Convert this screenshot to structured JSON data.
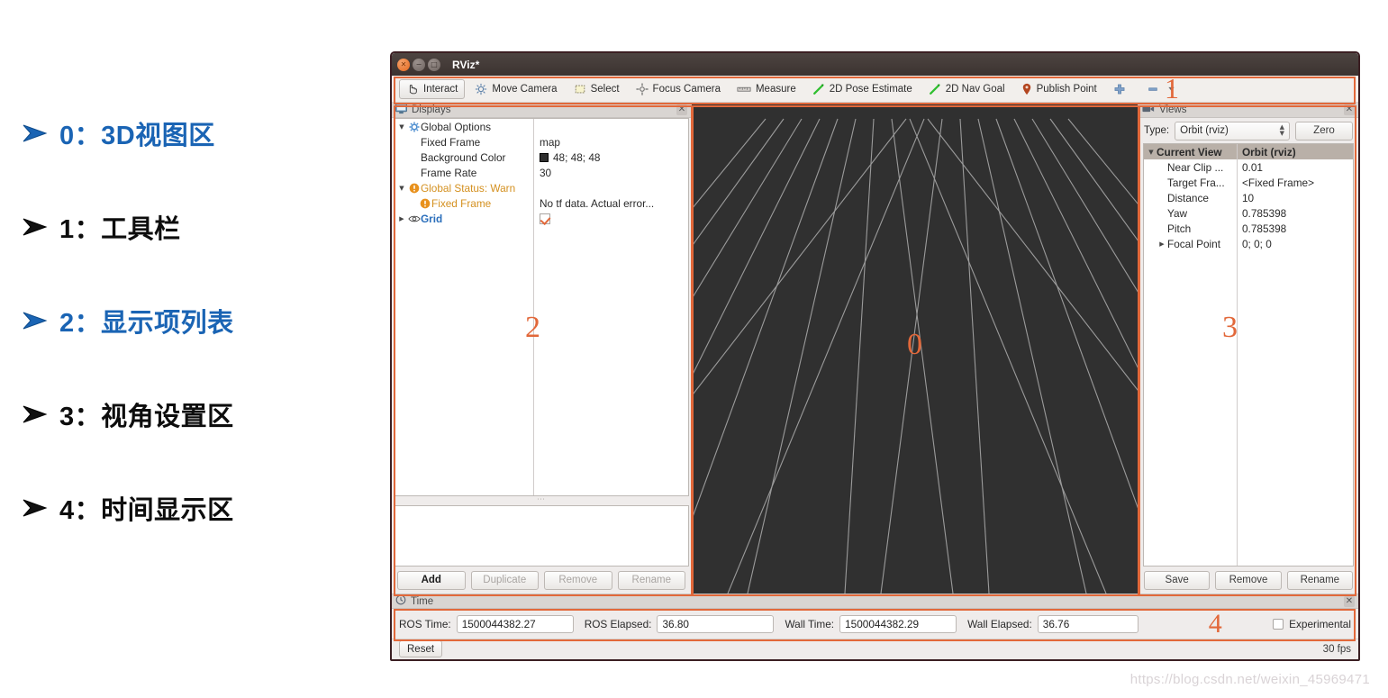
{
  "bullets": [
    {
      "num": "0",
      "label": "3D视图区",
      "color": "blue"
    },
    {
      "num": "1",
      "label": "工具栏",
      "color": "dark"
    },
    {
      "num": "2",
      "label": "显示项列表",
      "color": "blue"
    },
    {
      "num": "3",
      "label": "视角设置区",
      "color": "dark"
    },
    {
      "num": "4",
      "label": "时间显示区",
      "color": "dark"
    }
  ],
  "window": {
    "title": "RViz*",
    "close_glyph": "✕",
    "minimize_glyph": "−",
    "maximize_glyph": "□"
  },
  "toolbar": {
    "items": [
      {
        "label": "Interact",
        "icon": "hand-cursor-icon",
        "active": true
      },
      {
        "label": "Move Camera",
        "icon": "move-camera-icon",
        "active": false
      },
      {
        "label": "Select",
        "icon": "select-rect-icon",
        "active": false
      },
      {
        "label": "Focus Camera",
        "icon": "focus-camera-icon",
        "active": false
      },
      {
        "label": "Measure",
        "icon": "measure-icon",
        "active": false
      },
      {
        "label": "2D Pose Estimate",
        "icon": "pose-arrow-icon",
        "active": false
      },
      {
        "label": "2D Nav Goal",
        "icon": "nav-goal-arrow-icon",
        "active": false
      },
      {
        "label": "Publish Point",
        "icon": "map-pin-icon",
        "active": false
      }
    ],
    "plus_icon": "plus-icon",
    "minus_icon": "minus-icon",
    "overflow_icon": "chevron-down-icon"
  },
  "displays": {
    "panel_title": "Displays",
    "panel_icon": "monitor-icon",
    "close_glyph": "✕",
    "rows": [
      {
        "indent": 0,
        "twisty": "▼",
        "icon": "gear-icon",
        "label": "Global Options",
        "value": "",
        "style": "bold-dark",
        "value_style": ""
      },
      {
        "indent": 1,
        "twisty": "",
        "icon": "",
        "label": "Fixed Frame",
        "value": "map",
        "style": "",
        "value_style": ""
      },
      {
        "indent": 1,
        "twisty": "",
        "icon": "",
        "label": "Background Color",
        "value": "48; 48; 48",
        "style": "",
        "value_style": "swatch"
      },
      {
        "indent": 1,
        "twisty": "",
        "icon": "",
        "label": "Frame Rate",
        "value": "30",
        "style": "",
        "value_style": ""
      },
      {
        "indent": 0,
        "twisty": "▼",
        "icon": "warning-icon",
        "label": "Global Status: Warn",
        "value": "",
        "style": "warn",
        "value_style": ""
      },
      {
        "indent": 1,
        "twisty": "",
        "icon": "warning-icon",
        "label": "Fixed Frame",
        "value": "No tf data.  Actual error...",
        "style": "warn",
        "value_style": ""
      },
      {
        "indent": 0,
        "twisty": "▶",
        "icon": "eye-icon",
        "label": "Grid",
        "value": "",
        "style": "link",
        "value_style": "checkbox"
      }
    ],
    "buttons": [
      {
        "label": "Add",
        "enabled": true
      },
      {
        "label": "Duplicate",
        "enabled": false
      },
      {
        "label": "Remove",
        "enabled": false
      },
      {
        "label": "Rename",
        "enabled": false
      }
    ]
  },
  "views": {
    "panel_title": "Views",
    "panel_icon": "camera-icon",
    "close_glyph": "✕",
    "type_label": "Type:",
    "type_value": "Orbit (rviz)",
    "zero_button": "Zero",
    "header": {
      "name": "Current View",
      "value": "Orbit (rviz)",
      "twisty": "▼"
    },
    "rows": [
      {
        "twisty": "",
        "name": "Near Clip ...",
        "value": "0.01"
      },
      {
        "twisty": "",
        "name": "Target Fra...",
        "value": "<Fixed Frame>"
      },
      {
        "twisty": "",
        "name": "Distance",
        "value": "10"
      },
      {
        "twisty": "",
        "name": "Yaw",
        "value": "0.785398"
      },
      {
        "twisty": "",
        "name": "Pitch",
        "value": "0.785398"
      },
      {
        "twisty": "▶",
        "name": "Focal Point",
        "value": "0; 0; 0"
      }
    ],
    "buttons": [
      {
        "label": "Save",
        "enabled": true
      },
      {
        "label": "Remove",
        "enabled": true
      },
      {
        "label": "Rename",
        "enabled": true
      }
    ]
  },
  "time": {
    "panel_title": "Time",
    "panel_icon": "clock-icon",
    "close_glyph": "✕",
    "fields": [
      {
        "label": "ROS Time:",
        "value": "1500044382.27"
      },
      {
        "label": "ROS Elapsed:",
        "value": "36.80"
      },
      {
        "label": "Wall Time:",
        "value": "1500044382.29"
      },
      {
        "label": "Wall Elapsed:",
        "value": "36.76"
      }
    ],
    "experimental_label": "Experimental",
    "experimental_checked": false
  },
  "statusbar": {
    "reset_label": "Reset",
    "fps": "30 fps"
  },
  "annotations": {
    "view3d": "0",
    "toolbar": "1",
    "displays": "2",
    "views": "3",
    "time": "4"
  },
  "watermark": "https://blog.csdn.net/weixin_45969471",
  "colors": {
    "accent_orange": "#e2683a",
    "link_blue": "#1a64b4",
    "warn": "#d4901f",
    "viewport_bg": "#303030"
  }
}
